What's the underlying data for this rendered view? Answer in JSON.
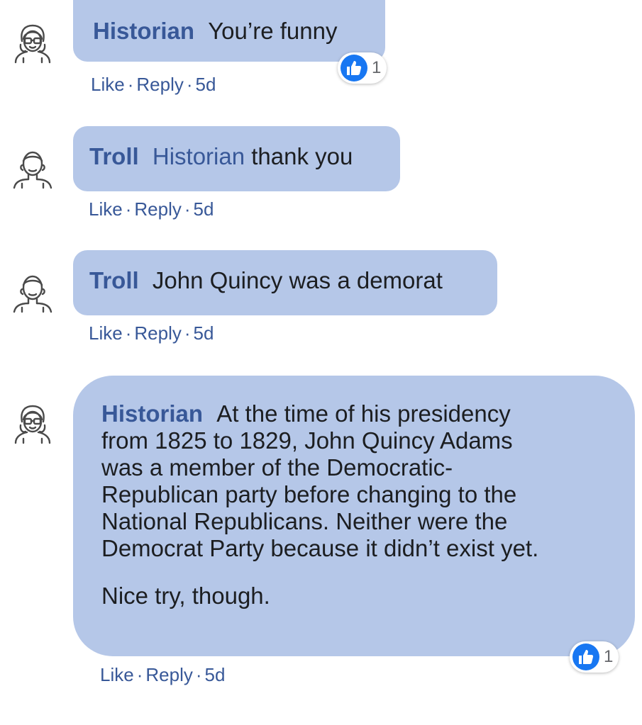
{
  "colors": {
    "bubble": "#b5c7e8",
    "link": "#385898",
    "like_blue": "#1877f2",
    "muted": "#65676b"
  },
  "comments": [
    {
      "author": "Historian",
      "avatar_icon": "woman-glasses-avatar-icon",
      "text": "You’re funny",
      "actions": {
        "like": "Like",
        "reply": "Reply",
        "time": "5d",
        "separator": "·"
      },
      "reaction": {
        "icon": "thumbs-up-icon",
        "count": "1"
      }
    },
    {
      "author": "Troll",
      "avatar_icon": "man-avatar-icon",
      "mention": "Historian",
      "text": "thank you",
      "actions": {
        "like": "Like",
        "reply": "Reply",
        "time": "5d",
        "separator": "·"
      }
    },
    {
      "author": "Troll",
      "avatar_icon": "man-avatar-icon",
      "text": "John Quincy was a demorat",
      "actions": {
        "like": "Like",
        "reply": "Reply",
        "time": "5d",
        "separator": "·"
      }
    },
    {
      "author": "Historian",
      "avatar_icon": "woman-glasses-avatar-icon",
      "lines": [
        "At the time of his presidency",
        "from 1825 to 1829, John Quincy Adams",
        "was a member of the Democratic-",
        "Republican party before changing to the",
        "National Republicans. Neither were the",
        "Democrat Party because it didn’t exist yet."
      ],
      "closing": "Nice try, though.",
      "actions": {
        "like": "Like",
        "reply": "Reply",
        "time": "5d",
        "separator": "·"
      },
      "reaction": {
        "icon": "thumbs-up-icon",
        "count": "1"
      }
    }
  ]
}
